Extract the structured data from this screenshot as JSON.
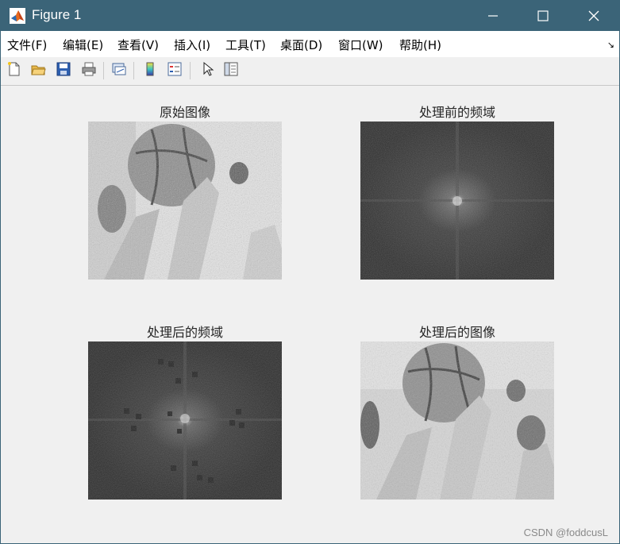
{
  "window": {
    "title": "Figure 1",
    "controls": {
      "minimize": "minimize-icon",
      "maximize": "maximize-icon",
      "close": "close-icon"
    }
  },
  "menubar": {
    "items": [
      {
        "label": "文件(F)"
      },
      {
        "label": "编辑(E)"
      },
      {
        "label": "查看(V)"
      },
      {
        "label": "插入(I)"
      },
      {
        "label": "工具(T)"
      },
      {
        "label": "桌面(D)"
      },
      {
        "label": "窗口(W)"
      },
      {
        "label": "帮助(H)"
      }
    ],
    "overflow_icon": "dock-arrow-icon"
  },
  "toolbar": {
    "buttons": [
      "new-figure-icon",
      "open-file-icon",
      "save-icon",
      "print-icon",
      "link-plot-icon",
      "colorbar-icon",
      "legend-icon",
      "pointer-icon",
      "property-inspector-icon"
    ]
  },
  "subplots": [
    {
      "title": "原始图像",
      "content": "grayscale-photo"
    },
    {
      "title": "处理前的频域",
      "content": "fft-spectrum"
    },
    {
      "title": "处理后的频域",
      "content": "fft-spectrum-filtered"
    },
    {
      "title": "处理后的图像",
      "content": "filtered-photo"
    }
  ],
  "watermark": "CSDN @foddcusL"
}
